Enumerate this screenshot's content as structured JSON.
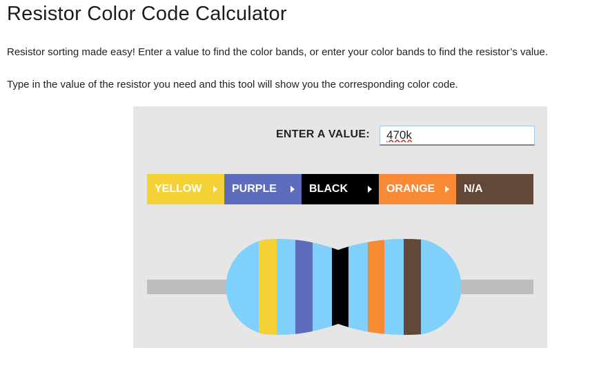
{
  "page": {
    "title": "Resistor Color Code Calculator",
    "intro": "Resistor sorting made easy! Enter a value to find the color bands, or enter your color bands to find the resistor’s value.",
    "instructions": "Type in the value of the resistor you need and this tool will show you the corresponding color code."
  },
  "calculator": {
    "value_label": "ENTER A VALUE:",
    "value_input": "470k",
    "bands": [
      {
        "label": "YELLOW",
        "color": "#f4d235"
      },
      {
        "label": "PURPLE",
        "color": "#5e6dbb"
      },
      {
        "label": "BLACK",
        "color": "#000000"
      },
      {
        "label": "ORANGE",
        "color": "#f88a35"
      },
      {
        "label": "N/A",
        "color": "#644837"
      }
    ],
    "resistor": {
      "body_color": "#7fd0fa",
      "lead_color": "#bdbdbd",
      "stripe_colors": [
        "#f4d235",
        "#5e6dbb",
        "#000000",
        "#f88a35",
        "#644837"
      ]
    }
  }
}
